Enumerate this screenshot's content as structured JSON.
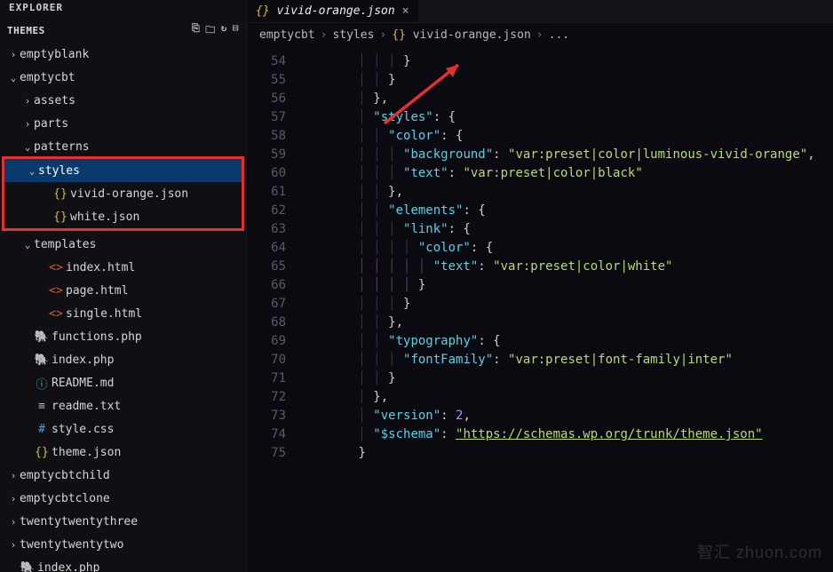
{
  "explorer_title": "EXPLORER",
  "section_title": "THEMES",
  "action_icons": [
    "new-file-icon",
    "new-folder-icon",
    "refresh-icon",
    "collapse-icon"
  ],
  "tree": [
    {
      "depth": 0,
      "chev": "›",
      "icon": "",
      "label": "emptyblank",
      "cls": ""
    },
    {
      "depth": 0,
      "chev": "⌄",
      "icon": "",
      "label": "emptycbt",
      "cls": ""
    },
    {
      "depth": 1,
      "chev": "›",
      "icon": "",
      "label": "assets",
      "cls": ""
    },
    {
      "depth": 1,
      "chev": "›",
      "icon": "",
      "label": "parts",
      "cls": ""
    },
    {
      "depth": 1,
      "chev": "⌄",
      "icon": "",
      "label": "patterns",
      "cls": ""
    },
    {
      "depth": 1,
      "chev": "⌄",
      "icon": "",
      "label": "styles",
      "cls": "sel",
      "hlStart": true
    },
    {
      "depth": 2,
      "chev": "",
      "icon": "{}",
      "iconCls": "ic-json",
      "label": "vivid-orange.json",
      "cls": ""
    },
    {
      "depth": 2,
      "chev": "",
      "icon": "{}",
      "iconCls": "ic-json",
      "label": "white.json",
      "cls": "",
      "hlEnd": true
    },
    {
      "depth": 1,
      "chev": "⌄",
      "icon": "",
      "label": "templates",
      "cls": ""
    },
    {
      "depth": 2,
      "chev": "",
      "icon": "<>",
      "iconCls": "ic-html",
      "label": "index.html",
      "cls": ""
    },
    {
      "depth": 2,
      "chev": "",
      "icon": "<>",
      "iconCls": "ic-html",
      "label": "page.html",
      "cls": ""
    },
    {
      "depth": 2,
      "chev": "",
      "icon": "<>",
      "iconCls": "ic-html",
      "label": "single.html",
      "cls": ""
    },
    {
      "depth": 1,
      "chev": "",
      "icon": "🐘",
      "iconCls": "ic-php",
      "label": "functions.php",
      "cls": ""
    },
    {
      "depth": 1,
      "chev": "",
      "icon": "🐘",
      "iconCls": "ic-php",
      "label": "index.php",
      "cls": ""
    },
    {
      "depth": 1,
      "chev": "",
      "icon": "ⓘ",
      "iconCls": "ic-info",
      "label": "README.md",
      "cls": ""
    },
    {
      "depth": 1,
      "chev": "",
      "icon": "≡",
      "iconCls": "ic-txt",
      "label": "readme.txt",
      "cls": ""
    },
    {
      "depth": 1,
      "chev": "",
      "icon": "#",
      "iconCls": "ic-css",
      "label": "style.css",
      "cls": ""
    },
    {
      "depth": 1,
      "chev": "",
      "icon": "{}",
      "iconCls": "ic-json",
      "label": "theme.json",
      "cls": ""
    },
    {
      "depth": 0,
      "chev": "›",
      "icon": "",
      "label": "emptycbtchild",
      "cls": ""
    },
    {
      "depth": 0,
      "chev": "›",
      "icon": "",
      "label": "emptycbtclone",
      "cls": ""
    },
    {
      "depth": 0,
      "chev": "›",
      "icon": "",
      "label": "twentytwentythree",
      "cls": ""
    },
    {
      "depth": 0,
      "chev": "›",
      "icon": "",
      "label": "twentytwentytwo",
      "cls": ""
    },
    {
      "depth": 0,
      "chev": "",
      "icon": "🐘",
      "iconCls": "ic-php",
      "label": "index.php",
      "cls": ""
    }
  ],
  "tab": {
    "icon": "{}",
    "label": "vivid-orange.json",
    "close": "×"
  },
  "breadcrumb": [
    "emptycbt",
    "styles",
    "{} vivid-orange.json",
    "..."
  ],
  "lines_start": 54,
  "lines_end": 75,
  "code_lines": [
    [
      [
        "ig",
        "        │ │ │ "
      ],
      [
        "punc",
        "}"
      ]
    ],
    [
      [
        "ig",
        "        │ │ "
      ],
      [
        "punc",
        "}"
      ]
    ],
    [
      [
        "ig",
        "        │ "
      ],
      [
        "punc",
        "},"
      ]
    ],
    [
      [
        "ig",
        "        │ "
      ],
      [
        "key",
        "\"styles\""
      ],
      [
        "punc",
        ": {"
      ]
    ],
    [
      [
        "ig",
        "        │ │ "
      ],
      [
        "key",
        "\"color\""
      ],
      [
        "punc",
        ": {"
      ]
    ],
    [
      [
        "ig",
        "        │ │ │ "
      ],
      [
        "key",
        "\"background\""
      ],
      [
        "punc",
        ": "
      ],
      [
        "str",
        "\"var:preset|color|luminous-vivid-orange\""
      ],
      [
        "punc",
        ","
      ]
    ],
    [
      [
        "ig",
        "        │ │ │ "
      ],
      [
        "key",
        "\"text\""
      ],
      [
        "punc",
        ": "
      ],
      [
        "str",
        "\"var:preset|color|black\""
      ]
    ],
    [
      [
        "ig",
        "        │ │ "
      ],
      [
        "punc",
        "},"
      ]
    ],
    [
      [
        "ig",
        "        │ │ "
      ],
      [
        "key",
        "\"elements\""
      ],
      [
        "punc",
        ": {"
      ]
    ],
    [
      [
        "ig",
        "        │ │ │ "
      ],
      [
        "key",
        "\"link\""
      ],
      [
        "punc",
        ": {"
      ]
    ],
    [
      [
        "ig",
        "        │ │ │ │ "
      ],
      [
        "key",
        "\"color\""
      ],
      [
        "punc",
        ": {"
      ]
    ],
    [
      [
        "igp",
        "        │ │ │ │ │ "
      ],
      [
        "key",
        "\"text\""
      ],
      [
        "punc",
        ": "
      ],
      [
        "str",
        "\"var:preset|color|white\""
      ]
    ],
    [
      [
        "igp",
        "        │ │ │ │ "
      ],
      [
        "punc",
        "}"
      ]
    ],
    [
      [
        "ig",
        "        │ │ │ "
      ],
      [
        "punc",
        "}"
      ]
    ],
    [
      [
        "ig",
        "        │ │ "
      ],
      [
        "punc",
        "},"
      ]
    ],
    [
      [
        "ig",
        "        │ │ "
      ],
      [
        "key",
        "\"typography\""
      ],
      [
        "punc",
        ": {"
      ]
    ],
    [
      [
        "ig",
        "        │ │ │ "
      ],
      [
        "key",
        "\"fontFamily\""
      ],
      [
        "punc",
        ": "
      ],
      [
        "str",
        "\"var:preset|font-family|inter\""
      ]
    ],
    [
      [
        "ig",
        "        │ │ "
      ],
      [
        "punc",
        "}"
      ]
    ],
    [
      [
        "ig",
        "        │ "
      ],
      [
        "punc",
        "},"
      ]
    ],
    [
      [
        "ig",
        "        │ "
      ],
      [
        "key",
        "\"version\""
      ],
      [
        "punc",
        ": "
      ],
      [
        "num",
        "2"
      ],
      [
        "punc",
        ","
      ]
    ],
    [
      [
        "ig",
        "        │ "
      ],
      [
        "key",
        "\"$schema\""
      ],
      [
        "punc",
        ": "
      ],
      [
        "url",
        "\"https://schemas.wp.org/trunk/theme.json\""
      ]
    ],
    [
      [
        "igy",
        "        "
      ],
      [
        "punc",
        "}"
      ]
    ]
  ],
  "watermark": "智汇 zhuon.com"
}
